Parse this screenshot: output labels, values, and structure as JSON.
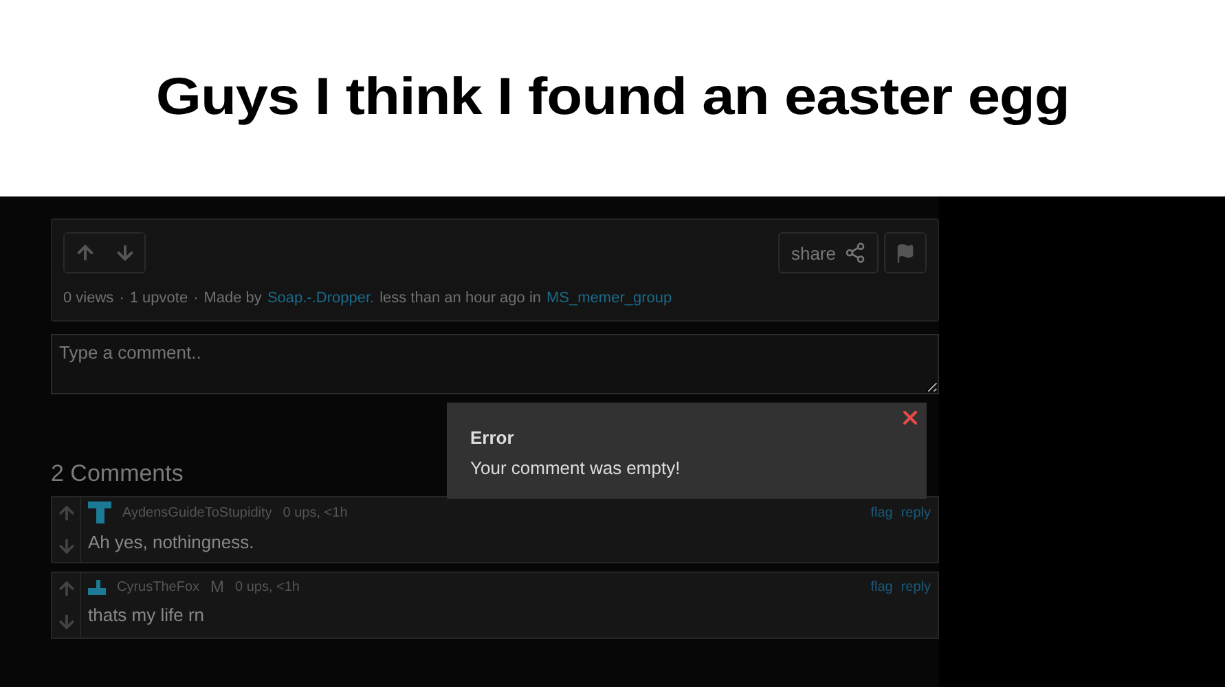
{
  "caption": "Guys I think I found an easter egg",
  "post": {
    "share_label": "share",
    "views": "0 views",
    "separator": "·",
    "upvotes": "1 upvote",
    "made_by": "Made by",
    "author": "Soap.-.Dropper.",
    "time": "less than an hour ago in",
    "group": "MS_memer_group"
  },
  "comment_box": {
    "placeholder": "Type a comment.."
  },
  "comments_heading": "2 Comments",
  "comments": [
    {
      "user": "AydensGuideToStupidity",
      "stats": "0 ups, <1h",
      "text": "Ah yes, nothingness.",
      "actions": [
        "flag",
        "reply"
      ]
    },
    {
      "user": "CyrusTheFox",
      "badge": "M",
      "stats": "0 ups, <1h",
      "text": "thats my life rn",
      "actions": [
        "flag",
        "reply"
      ]
    }
  ],
  "dialog": {
    "title": "Error",
    "message": "Your comment was empty!"
  }
}
